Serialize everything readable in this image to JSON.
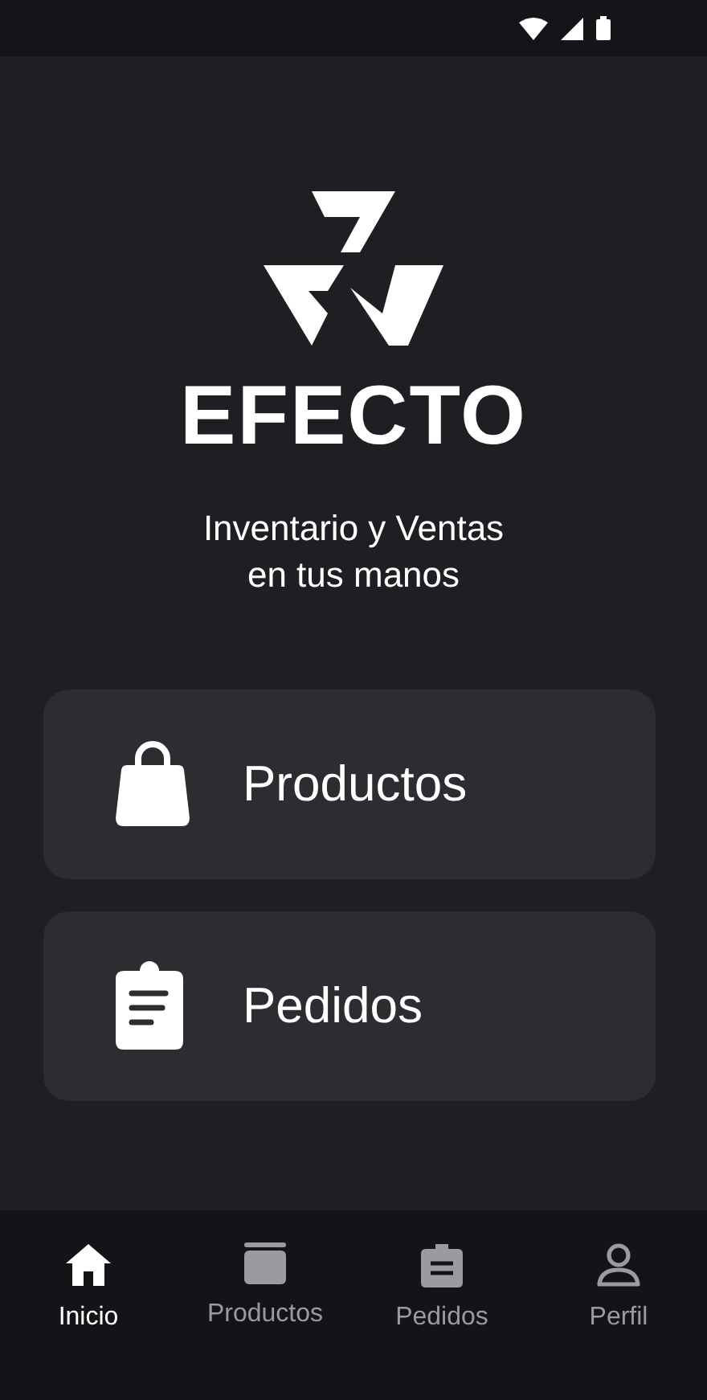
{
  "brand": {
    "name": "EFECTO",
    "tagline": "Inventario y Ventas\nen tus manos"
  },
  "menu": [
    {
      "kind": "bag",
      "label": "Productos"
    },
    {
      "kind": "clipboard",
      "label": "Pedidos"
    }
  ],
  "nav": [
    {
      "kind": "home",
      "label": "Inicio",
      "selected": true
    },
    {
      "kind": "box",
      "label": "Productos",
      "selected": false
    },
    {
      "kind": "clipboard",
      "label": "Pedidos",
      "selected": false
    },
    {
      "kind": "person",
      "label": "Perfil",
      "selected": false
    }
  ]
}
